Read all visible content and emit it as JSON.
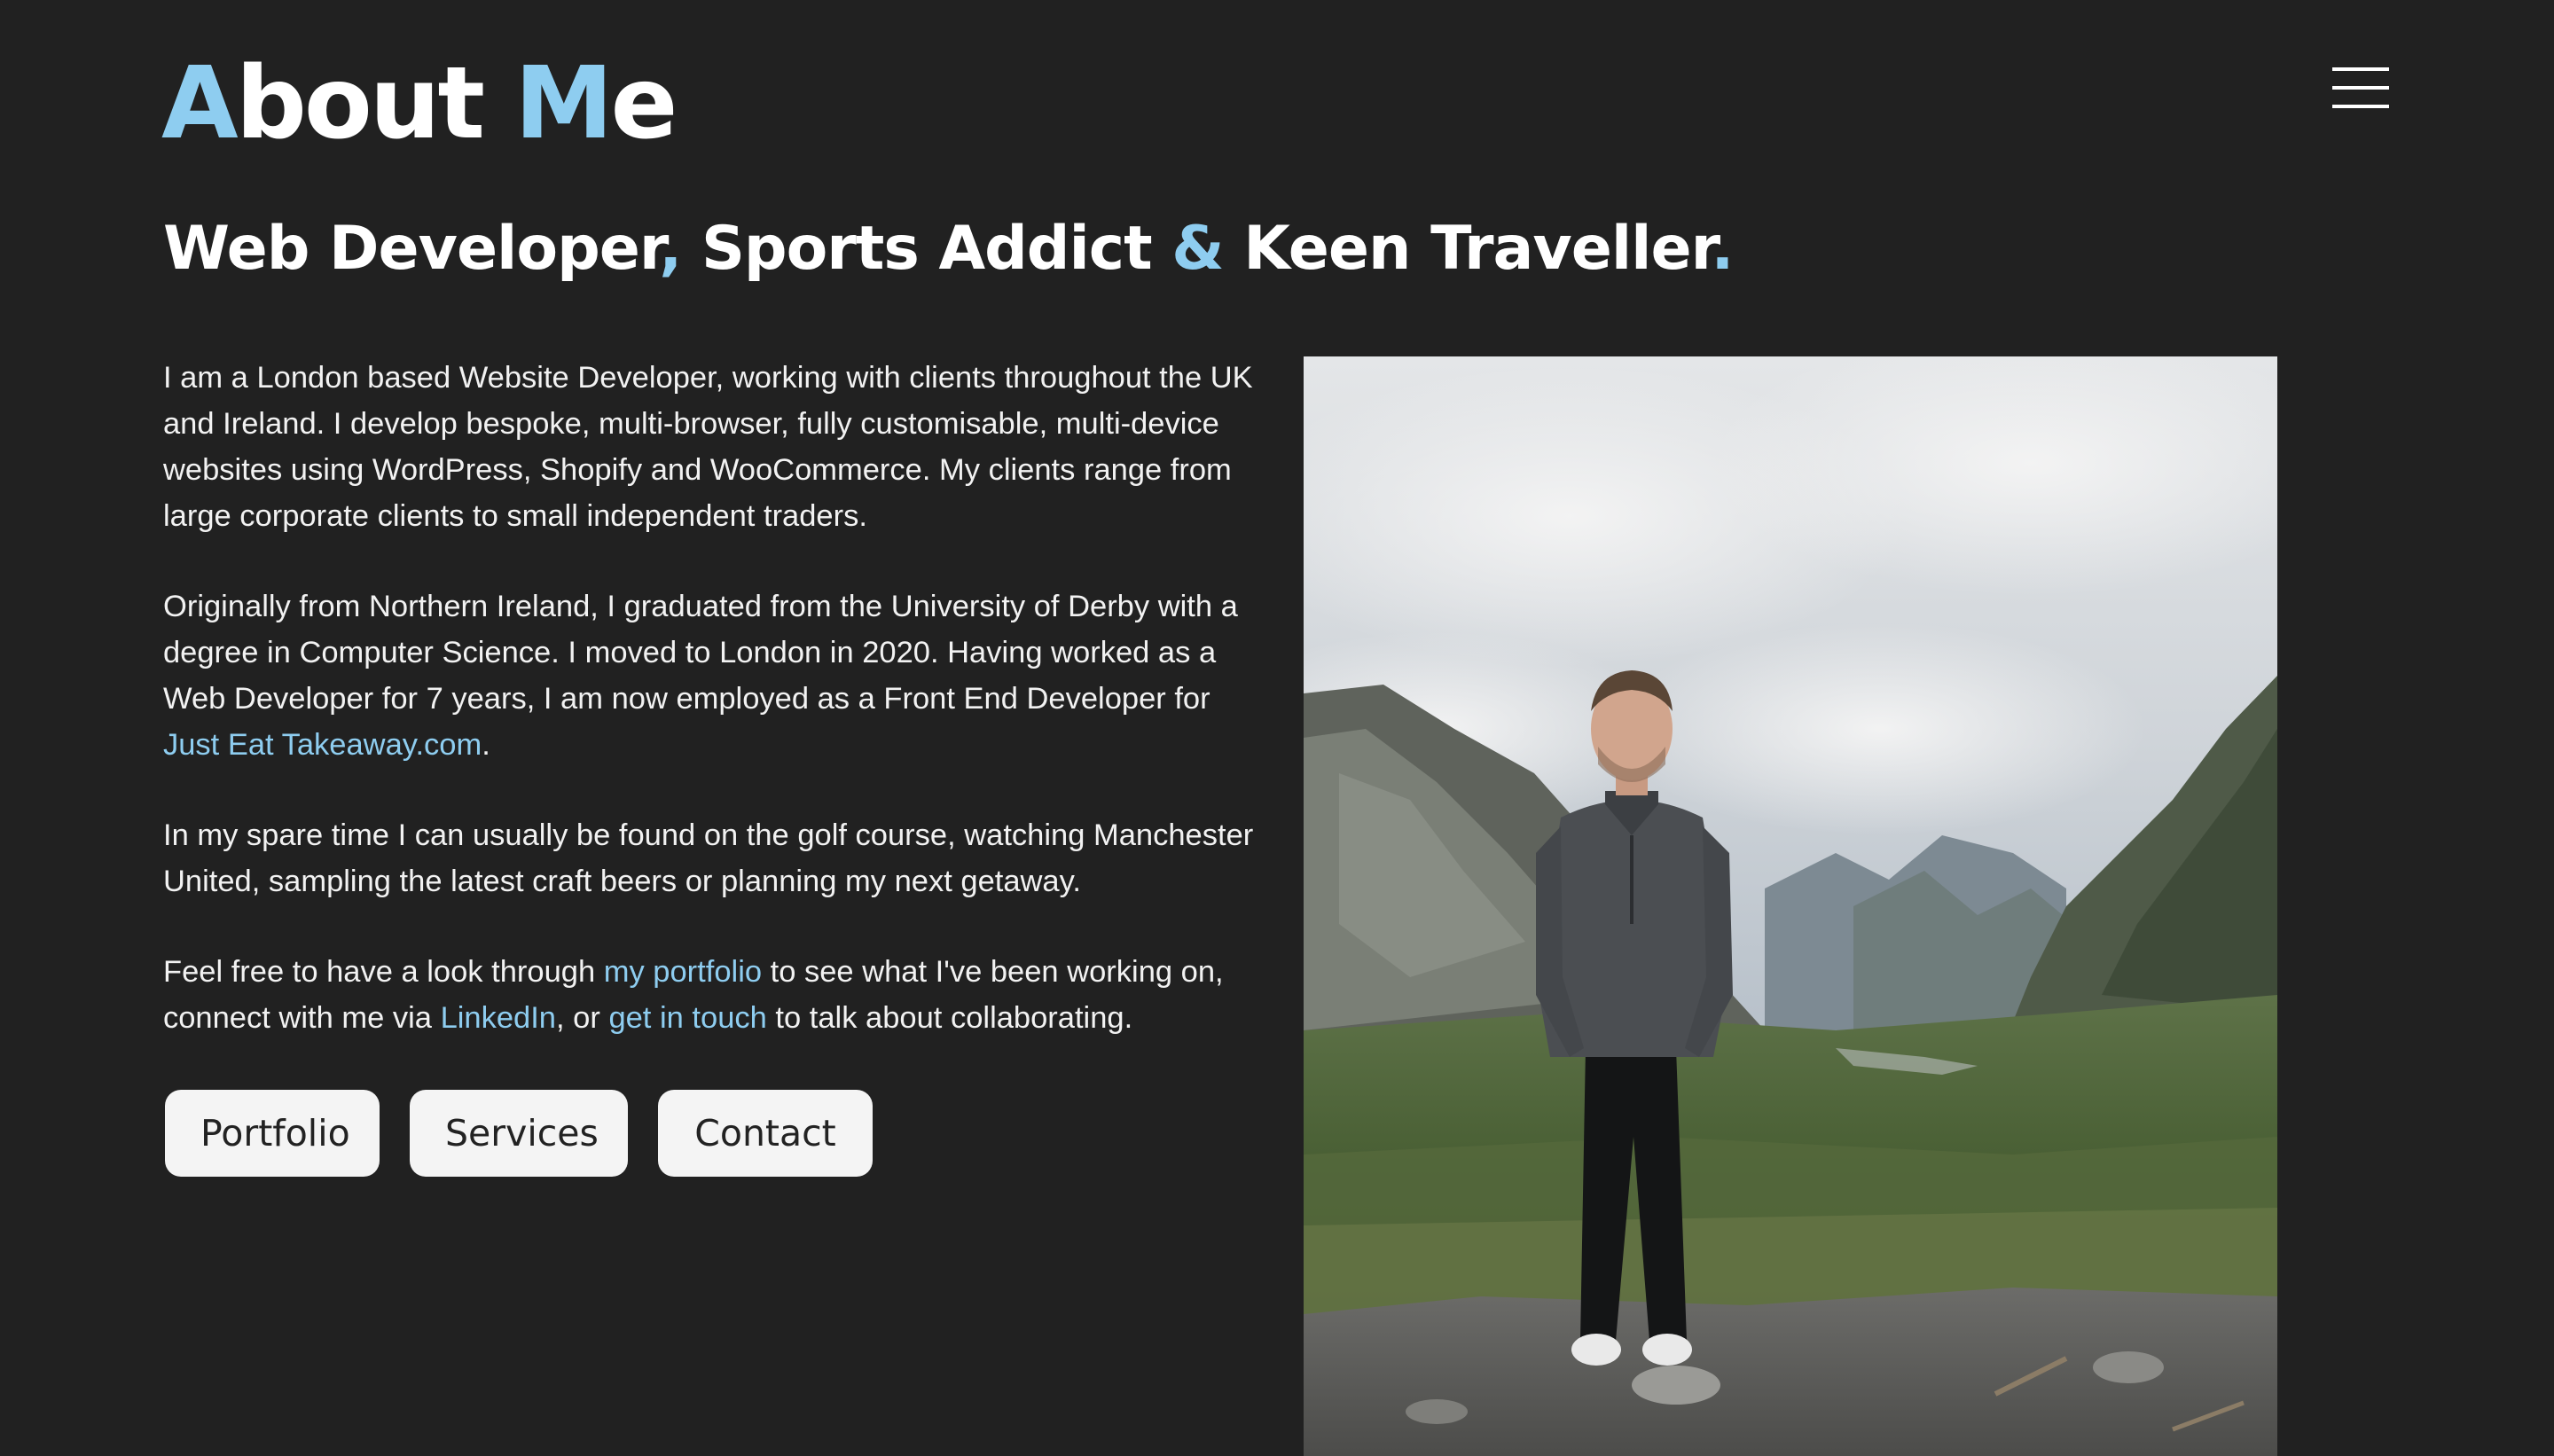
{
  "header": {
    "title_part1_accent": "A",
    "title_part2": "bout ",
    "title_part3_accent": "M",
    "title_part4": "e",
    "menu_icon": "hamburger-menu-icon"
  },
  "subtitle": {
    "part1": "Web Developer",
    "sep1": ",",
    "part2": " Sports Addict ",
    "sep2": "&",
    "part3": " Keen Traveller",
    "sep3": "."
  },
  "bio": {
    "p1": "I am a London based Website Developer, working with clients throughout the UK and Ireland. I develop bespoke, multi-browser, fully customisable, multi-device websites using WordPress, Shopify and WooCommerce. My clients range from large corporate clients to small independent traders.",
    "p2_text": "Originally from Northern Ireland, I graduated from the University of Derby with a degree in Computer Science. I moved to London in 2020. Having worked as a Web Developer for 7 years, I am now employed as a Front End Developer for ",
    "p2_link": "Just Eat Takeaway.com",
    "p2_end": ".",
    "p3": "In my spare time I can usually be found on the golf course, watching Manchester United, sampling the latest craft beers or planning my next getaway.",
    "p4_a": "Feel free to have a look through ",
    "p4_link_portfolio": "my portfolio",
    "p4_b": " to see what I've been working on, connect with me via ",
    "p4_link_linkedin": "LinkedIn",
    "p4_c": ", or ",
    "p4_link_contact": "get in touch",
    "p4_d": " to talk about collaborating."
  },
  "buttons": {
    "portfolio": "Portfolio",
    "services": "Services",
    "contact": "Contact"
  },
  "colors": {
    "background": "#212121",
    "accent": "#8ecdf0",
    "text": "#ffffff",
    "button_bg": "#f4f4f4"
  }
}
